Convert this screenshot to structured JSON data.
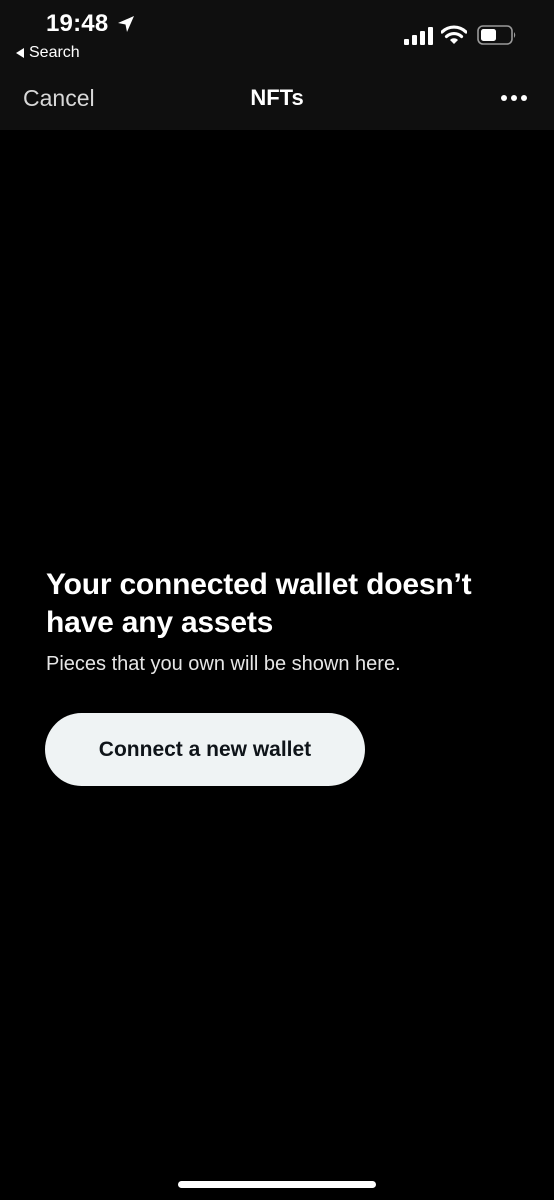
{
  "status_bar": {
    "time": "19:48",
    "back_label": "Search",
    "icons": [
      "location-arrow-icon",
      "cellular-signal-icon",
      "wifi-icon",
      "battery-icon"
    ]
  },
  "nav": {
    "cancel_label": "Cancel",
    "title": "NFTs",
    "more_icon": "more-horizontal-icon"
  },
  "empty_state": {
    "title": "Your connected wallet doesn’t have any assets",
    "subtitle": "Pieces that you own will be shown here.",
    "button_label": "Connect a new wallet"
  },
  "colors": {
    "background": "#000000",
    "header_background": "#0f0f0f",
    "button_background": "#eff3f4",
    "button_text": "#0f1419",
    "text_primary": "#ffffff"
  }
}
